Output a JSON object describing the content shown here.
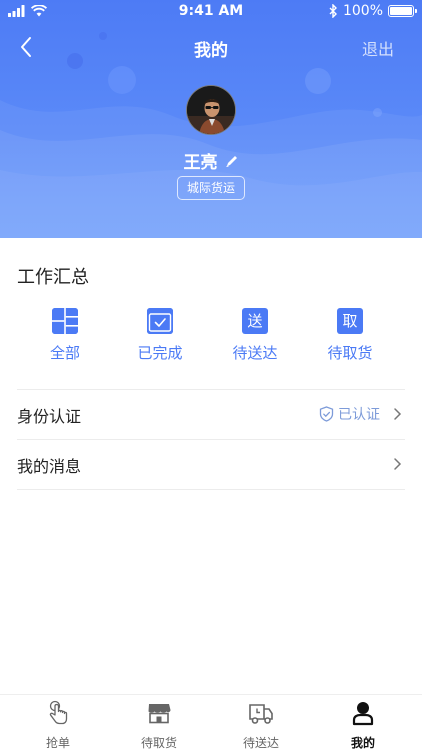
{
  "status_bar": {
    "time": "9:41 AM",
    "battery": "100%"
  },
  "nav": {
    "title": "我的",
    "logout_label": "退出"
  },
  "profile": {
    "name": "王亮",
    "role": "城际货运"
  },
  "work_summary": {
    "title": "工作汇总",
    "items": [
      {
        "label": "全部",
        "icon": "grid-icon",
        "glyph": ""
      },
      {
        "label": "已完成",
        "icon": "check-icon",
        "glyph": ""
      },
      {
        "label": "待送达",
        "icon": "deliver-icon",
        "glyph": "送"
      },
      {
        "label": "待取货",
        "icon": "pickup-icon",
        "glyph": "取"
      }
    ]
  },
  "menu": {
    "identity": {
      "label": "身份认证",
      "status": "已认证"
    },
    "messages": {
      "label": "我的消息"
    }
  },
  "tabbar": {
    "items": [
      {
        "label": "抢单",
        "icon": "hand-tap-icon"
      },
      {
        "label": "待取货",
        "icon": "shop-icon"
      },
      {
        "label": "待送达",
        "icon": "truck-icon"
      },
      {
        "label": "我的",
        "icon": "person-icon"
      }
    ],
    "active": "我的"
  },
  "colors": {
    "primary": "#4b7af5",
    "header_top": "#4d7bf5",
    "header_bottom": "#6a9bfb",
    "verified": "#7d9bd9"
  }
}
